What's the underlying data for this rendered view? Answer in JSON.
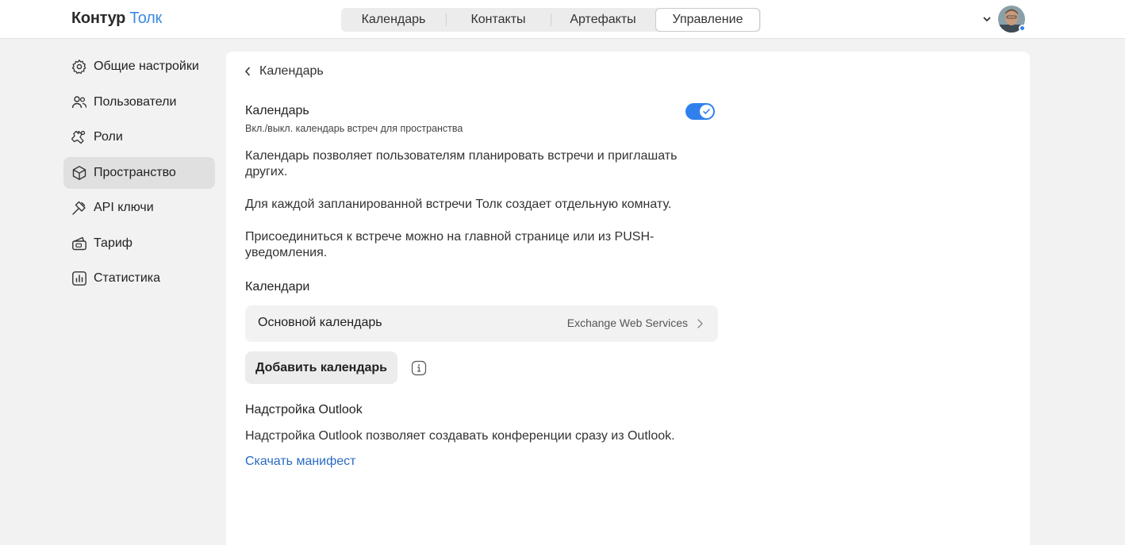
{
  "app": {
    "brand_part1": "Контур",
    "brand_part2": "Толк"
  },
  "top_tabs": [
    {
      "label": "Календарь",
      "active": false
    },
    {
      "label": "Контакты",
      "active": false
    },
    {
      "label": "Артефакты",
      "active": false
    },
    {
      "label": "Управление",
      "active": true
    }
  ],
  "user": {
    "avatar_icon": "user-avatar",
    "status_color": "#2f80ed"
  },
  "sidebar": {
    "items": [
      {
        "label": "Общие настройки",
        "icon": "gear-icon",
        "active": false
      },
      {
        "label": "Пользователи",
        "icon": "users-icon",
        "active": false
      },
      {
        "label": "Роли",
        "icon": "roles-icon",
        "active": false
      },
      {
        "label": "Пространство",
        "icon": "cube-icon",
        "active": true
      },
      {
        "label": "API ключи",
        "icon": "api-key-icon",
        "active": false
      },
      {
        "label": "Тариф",
        "icon": "tariff-icon",
        "active": false
      },
      {
        "label": "Статистика",
        "icon": "chart-icon",
        "active": false
      }
    ]
  },
  "main": {
    "back_label": "Календарь",
    "calendar_section": {
      "title": "Календарь",
      "subtitle": "Вкл./выкл. календарь встреч для пространства",
      "enabled": true
    },
    "paragraphs": [
      "Календарь позволяет пользователям планировать встречи и приглашать других.",
      "Для каждой запланированной встречи Толк создает отдельную комнату.",
      "Присоединиться к встрече можно на главной странице или из PUSH-уведомления."
    ],
    "calendars_heading": "Календари",
    "calendars": [
      {
        "name": "Основной календарь",
        "type": "Exchange Web Services"
      }
    ],
    "add_calendar_label": "Добавить календарь",
    "outlook": {
      "heading": "Надстройка Outlook",
      "text": "Надстройка Outlook позволяет создавать конференции сразу из Outlook.",
      "link": "Скачать манифест"
    }
  },
  "colors": {
    "accent": "#2f80ed",
    "link": "#2a6ac4",
    "brand_blue": "#3d8be0"
  }
}
